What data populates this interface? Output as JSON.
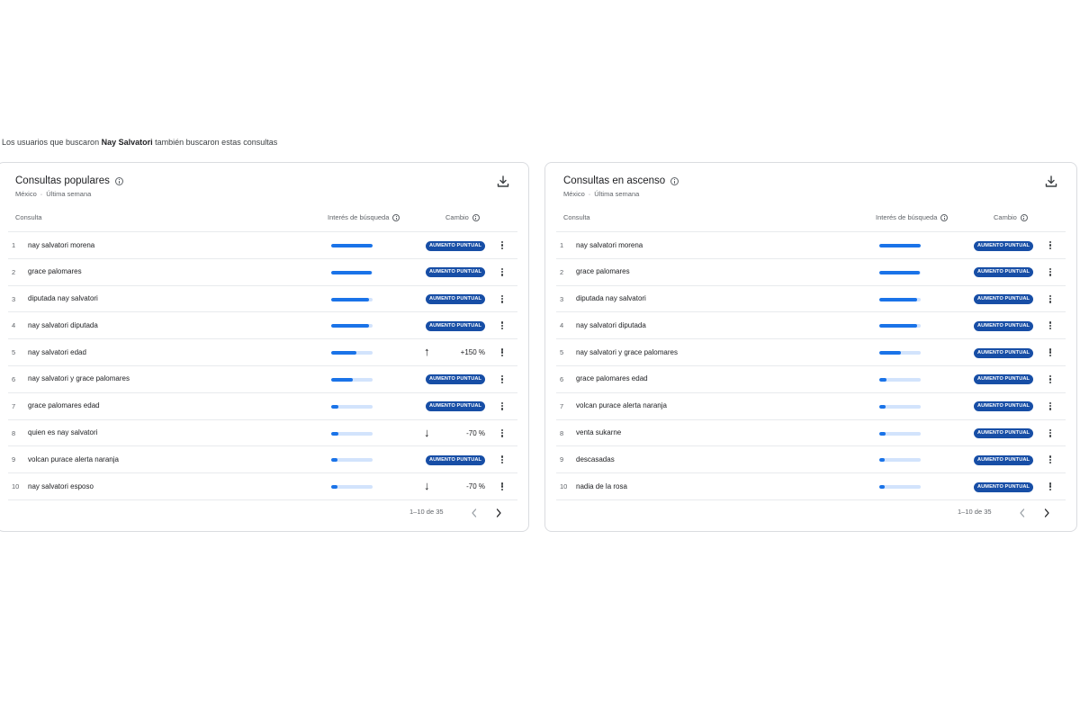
{
  "intro": {
    "before": "Los usuarios que buscaron",
    "name": "Nay Salvatori",
    "after": "también buscaron estas consultas"
  },
  "panels": [
    {
      "title": "Consultas populares",
      "region": "México",
      "period": "Última semana",
      "col_query": "Consulta",
      "col_interest": "Interés de búsqueda",
      "col_change": "Cambio",
      "pager": "1–10 de 35",
      "rows": [
        {
          "idx": "1",
          "query": "nay salvatori morena",
          "interest": 1.0,
          "change": "AUMENTO PUNTUAL",
          "type": "badge"
        },
        {
          "idx": "2",
          "query": "grace palomares",
          "interest": 0.98,
          "change": "AUMENTO PUNTUAL",
          "type": "badge"
        },
        {
          "idx": "3",
          "query": "diputada nay salvatori",
          "interest": 0.92,
          "change": "AUMENTO PUNTUAL",
          "type": "badge"
        },
        {
          "idx": "4",
          "query": "nay salvatori diputada",
          "interest": 0.92,
          "change": "AUMENTO PUNTUAL",
          "type": "badge"
        },
        {
          "idx": "5",
          "query": "nay salvatori edad",
          "interest": 0.6,
          "change": "+150 %",
          "type": "up"
        },
        {
          "idx": "6",
          "query": "nay salvatori y grace palomares",
          "interest": 0.52,
          "change": "AUMENTO PUNTUAL",
          "type": "badge"
        },
        {
          "idx": "7",
          "query": "grace palomares edad",
          "interest": 0.18,
          "change": "AUMENTO PUNTUAL",
          "type": "badge"
        },
        {
          "idx": "8",
          "query": "quien es nay salvatori",
          "interest": 0.17,
          "change": "-70 %",
          "type": "down"
        },
        {
          "idx": "9",
          "query": "volcan purace alerta naranja",
          "interest": 0.16,
          "change": "AUMENTO PUNTUAL",
          "type": "badge"
        },
        {
          "idx": "10",
          "query": "nay salvatori esposo",
          "interest": 0.16,
          "change": "-70 %",
          "type": "down"
        }
      ]
    },
    {
      "title": "Consultas en ascenso",
      "region": "México",
      "period": "Última semana",
      "col_query": "Consulta",
      "col_interest": "Interés de búsqueda",
      "col_change": "Cambio",
      "pager": "1–10 de 35",
      "rows": [
        {
          "idx": "1",
          "query": "nay salvatori morena",
          "interest": 1.0,
          "change": "AUMENTO PUNTUAL",
          "type": "badge"
        },
        {
          "idx": "2",
          "query": "grace palomares",
          "interest": 0.98,
          "change": "AUMENTO PUNTUAL",
          "type": "badge"
        },
        {
          "idx": "3",
          "query": "diputada nay salvatori",
          "interest": 0.92,
          "change": "AUMENTO PUNTUAL",
          "type": "badge"
        },
        {
          "idx": "4",
          "query": "nay salvatori diputada",
          "interest": 0.92,
          "change": "AUMENTO PUNTUAL",
          "type": "badge"
        },
        {
          "idx": "5",
          "query": "nay salvatori y grace palomares",
          "interest": 0.52,
          "change": "AUMENTO PUNTUAL",
          "type": "badge"
        },
        {
          "idx": "6",
          "query": "grace palomares edad",
          "interest": 0.18,
          "change": "AUMENTO PUNTUAL",
          "type": "badge"
        },
        {
          "idx": "7",
          "query": "volcan purace alerta naranja",
          "interest": 0.16,
          "change": "AUMENTO PUNTUAL",
          "type": "badge"
        },
        {
          "idx": "8",
          "query": "venta sukarne",
          "interest": 0.16,
          "change": "AUMENTO PUNTUAL",
          "type": "badge"
        },
        {
          "idx": "9",
          "query": "descasadas",
          "interest": 0.14,
          "change": "AUMENTO PUNTUAL",
          "type": "badge"
        },
        {
          "idx": "10",
          "query": "nadia de la rosa",
          "interest": 0.14,
          "change": "AUMENTO PUNTUAL",
          "type": "badge"
        }
      ]
    }
  ],
  "colors": {
    "accent": "#1a73e8",
    "bar_track": "#d2e3fc",
    "badge": "#174ea6"
  },
  "icons": {
    "download": "download-icon",
    "info": "info-icon",
    "more": "more-vert-icon",
    "prev": "chevron-left-icon",
    "next": "chevron-right-icon",
    "up": "arrow-up-icon",
    "down": "arrow-down-icon"
  }
}
